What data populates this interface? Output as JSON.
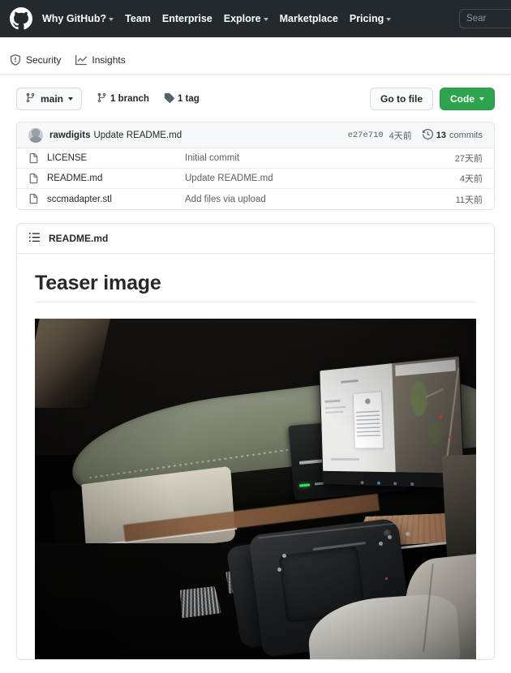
{
  "header": {
    "logo_icon": "github-octocat-icon",
    "nav": [
      {
        "label": "Why GitHub?",
        "caret": true
      },
      {
        "label": "Team",
        "caret": false
      },
      {
        "label": "Enterprise",
        "caret": false
      },
      {
        "label": "Explore",
        "caret": true
      },
      {
        "label": "Marketplace",
        "caret": false
      },
      {
        "label": "Pricing",
        "caret": true
      }
    ],
    "search_placeholder": "Sear",
    "background_color": "#24292e"
  },
  "repo_nav": {
    "tabs": [
      {
        "label": "Security",
        "icon": "shield-icon"
      },
      {
        "label": "Insights",
        "icon": "graph-icon"
      }
    ]
  },
  "branch_bar": {
    "branch_name": "main",
    "branch_icon": "git-branch-icon",
    "branch_count": "1 branch",
    "tag_count": "1 tag",
    "tag_icon": "tag-icon",
    "go_to_file_label": "Go to file",
    "code_label": "Code",
    "code_button_color": "#2ea44f"
  },
  "commit_bar": {
    "author": "rawdigits",
    "message": "Update README.md",
    "sha": "e27e710",
    "date": "4天前",
    "commits_count": "13",
    "commits_label": "commits",
    "history_icon": "history-icon"
  },
  "files": {
    "columns": [
      "name",
      "message",
      "age"
    ],
    "rows": [
      {
        "icon": "file-icon",
        "name": "LICENSE",
        "message": "Initial commit",
        "age": "27天前"
      },
      {
        "icon": "file-icon",
        "name": "README.md",
        "message": "Update README.md",
        "age": "4天前"
      },
      {
        "icon": "file-icon",
        "name": "sccmadapter.stl",
        "message": "Add files via upload",
        "age": "11天前"
      }
    ]
  },
  "readme": {
    "title": "README.md",
    "icon": "list-unordered-icon",
    "heading": "Teaser image",
    "image_alt": "Tesla car interior at night showing dashboard, center touchscreen with map, yoke steering wheel, wood trim and white seats"
  }
}
